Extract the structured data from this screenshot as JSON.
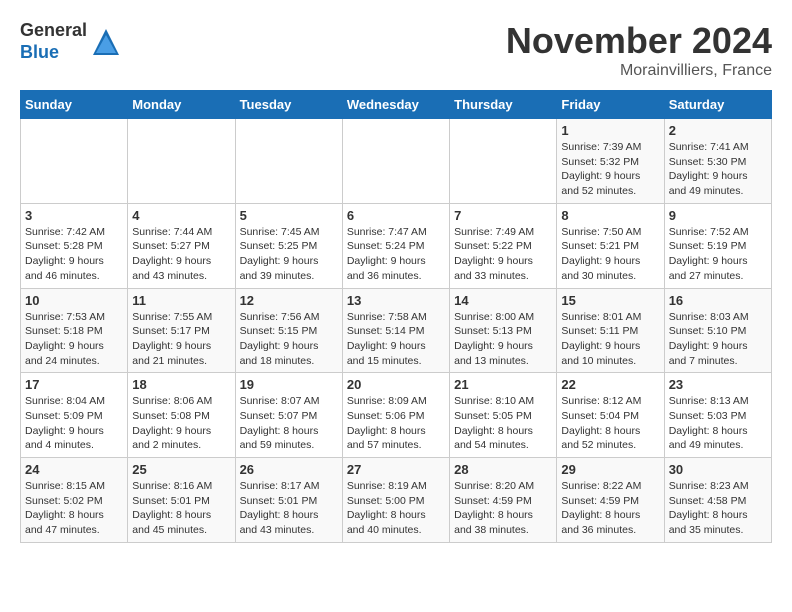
{
  "logo": {
    "line1": "General",
    "line2": "Blue"
  },
  "title": "November 2024",
  "location": "Morainvilliers, France",
  "weekdays": [
    "Sunday",
    "Monday",
    "Tuesday",
    "Wednesday",
    "Thursday",
    "Friday",
    "Saturday"
  ],
  "weeks": [
    [
      {
        "day": "",
        "info": ""
      },
      {
        "day": "",
        "info": ""
      },
      {
        "day": "",
        "info": ""
      },
      {
        "day": "",
        "info": ""
      },
      {
        "day": "",
        "info": ""
      },
      {
        "day": "1",
        "info": "Sunrise: 7:39 AM\nSunset: 5:32 PM\nDaylight: 9 hours\nand 52 minutes."
      },
      {
        "day": "2",
        "info": "Sunrise: 7:41 AM\nSunset: 5:30 PM\nDaylight: 9 hours\nand 49 minutes."
      }
    ],
    [
      {
        "day": "3",
        "info": "Sunrise: 7:42 AM\nSunset: 5:28 PM\nDaylight: 9 hours\nand 46 minutes."
      },
      {
        "day": "4",
        "info": "Sunrise: 7:44 AM\nSunset: 5:27 PM\nDaylight: 9 hours\nand 43 minutes."
      },
      {
        "day": "5",
        "info": "Sunrise: 7:45 AM\nSunset: 5:25 PM\nDaylight: 9 hours\nand 39 minutes."
      },
      {
        "day": "6",
        "info": "Sunrise: 7:47 AM\nSunset: 5:24 PM\nDaylight: 9 hours\nand 36 minutes."
      },
      {
        "day": "7",
        "info": "Sunrise: 7:49 AM\nSunset: 5:22 PM\nDaylight: 9 hours\nand 33 minutes."
      },
      {
        "day": "8",
        "info": "Sunrise: 7:50 AM\nSunset: 5:21 PM\nDaylight: 9 hours\nand 30 minutes."
      },
      {
        "day": "9",
        "info": "Sunrise: 7:52 AM\nSunset: 5:19 PM\nDaylight: 9 hours\nand 27 minutes."
      }
    ],
    [
      {
        "day": "10",
        "info": "Sunrise: 7:53 AM\nSunset: 5:18 PM\nDaylight: 9 hours\nand 24 minutes."
      },
      {
        "day": "11",
        "info": "Sunrise: 7:55 AM\nSunset: 5:17 PM\nDaylight: 9 hours\nand 21 minutes."
      },
      {
        "day": "12",
        "info": "Sunrise: 7:56 AM\nSunset: 5:15 PM\nDaylight: 9 hours\nand 18 minutes."
      },
      {
        "day": "13",
        "info": "Sunrise: 7:58 AM\nSunset: 5:14 PM\nDaylight: 9 hours\nand 15 minutes."
      },
      {
        "day": "14",
        "info": "Sunrise: 8:00 AM\nSunset: 5:13 PM\nDaylight: 9 hours\nand 13 minutes."
      },
      {
        "day": "15",
        "info": "Sunrise: 8:01 AM\nSunset: 5:11 PM\nDaylight: 9 hours\nand 10 minutes."
      },
      {
        "day": "16",
        "info": "Sunrise: 8:03 AM\nSunset: 5:10 PM\nDaylight: 9 hours\nand 7 minutes."
      }
    ],
    [
      {
        "day": "17",
        "info": "Sunrise: 8:04 AM\nSunset: 5:09 PM\nDaylight: 9 hours\nand 4 minutes."
      },
      {
        "day": "18",
        "info": "Sunrise: 8:06 AM\nSunset: 5:08 PM\nDaylight: 9 hours\nand 2 minutes."
      },
      {
        "day": "19",
        "info": "Sunrise: 8:07 AM\nSunset: 5:07 PM\nDaylight: 8 hours\nand 59 minutes."
      },
      {
        "day": "20",
        "info": "Sunrise: 8:09 AM\nSunset: 5:06 PM\nDaylight: 8 hours\nand 57 minutes."
      },
      {
        "day": "21",
        "info": "Sunrise: 8:10 AM\nSunset: 5:05 PM\nDaylight: 8 hours\nand 54 minutes."
      },
      {
        "day": "22",
        "info": "Sunrise: 8:12 AM\nSunset: 5:04 PM\nDaylight: 8 hours\nand 52 minutes."
      },
      {
        "day": "23",
        "info": "Sunrise: 8:13 AM\nSunset: 5:03 PM\nDaylight: 8 hours\nand 49 minutes."
      }
    ],
    [
      {
        "day": "24",
        "info": "Sunrise: 8:15 AM\nSunset: 5:02 PM\nDaylight: 8 hours\nand 47 minutes."
      },
      {
        "day": "25",
        "info": "Sunrise: 8:16 AM\nSunset: 5:01 PM\nDaylight: 8 hours\nand 45 minutes."
      },
      {
        "day": "26",
        "info": "Sunrise: 8:17 AM\nSunset: 5:01 PM\nDaylight: 8 hours\nand 43 minutes."
      },
      {
        "day": "27",
        "info": "Sunrise: 8:19 AM\nSunset: 5:00 PM\nDaylight: 8 hours\nand 40 minutes."
      },
      {
        "day": "28",
        "info": "Sunrise: 8:20 AM\nSunset: 4:59 PM\nDaylight: 8 hours\nand 38 minutes."
      },
      {
        "day": "29",
        "info": "Sunrise: 8:22 AM\nSunset: 4:59 PM\nDaylight: 8 hours\nand 36 minutes."
      },
      {
        "day": "30",
        "info": "Sunrise: 8:23 AM\nSunset: 4:58 PM\nDaylight: 8 hours\nand 35 minutes."
      }
    ]
  ]
}
